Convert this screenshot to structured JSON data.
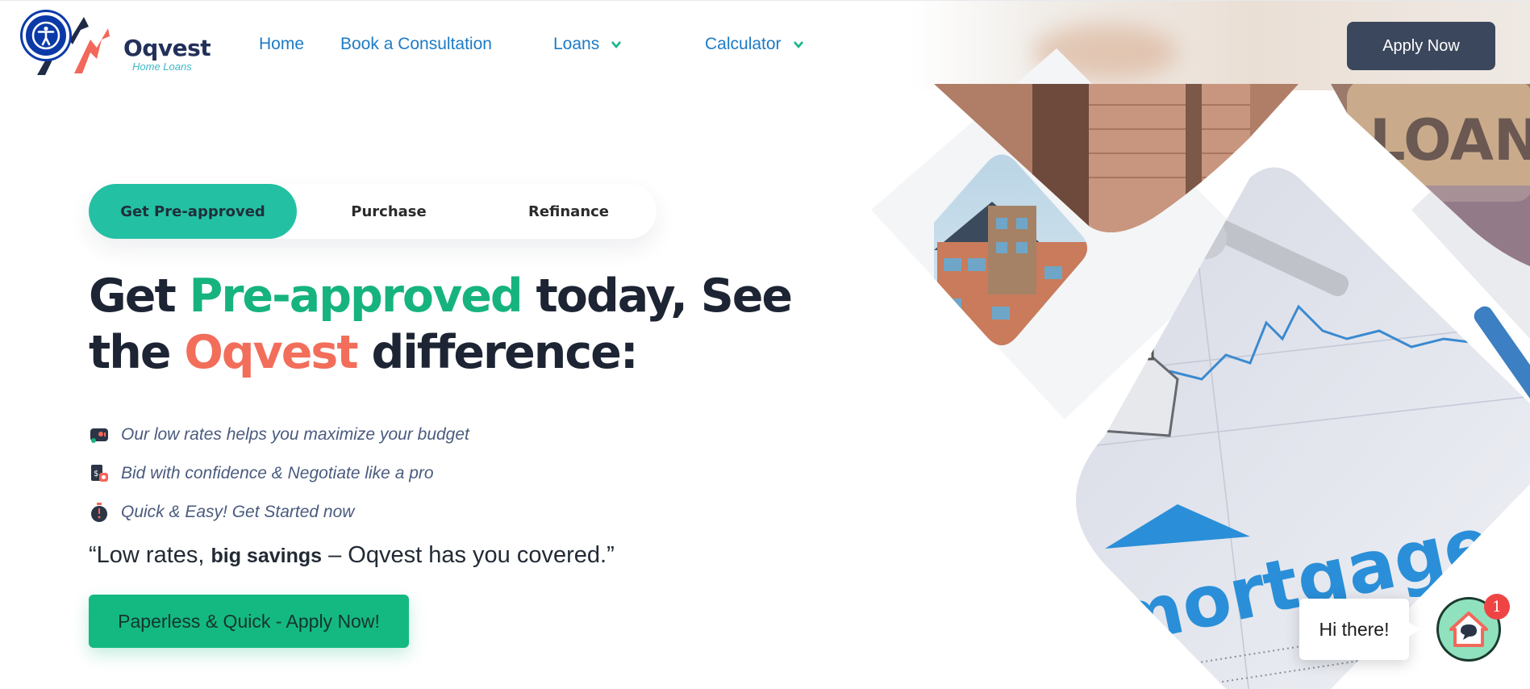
{
  "header": {
    "logo": {
      "name": "Oqvest",
      "tagline": "Home Loans"
    },
    "nav": [
      {
        "label": "Home"
      },
      {
        "label": "Book a Consultation"
      },
      {
        "label": "Loans",
        "has_dropdown": true
      },
      {
        "label": "Calculator",
        "has_dropdown": true
      }
    ],
    "apply_button": "Apply Now"
  },
  "hero": {
    "tabs": [
      {
        "label": "Get Pre-approved",
        "active": true
      },
      {
        "label": "Purchase",
        "active": false
      },
      {
        "label": "Refinance",
        "active": false
      }
    ],
    "headline": {
      "part1": "Get ",
      "highlight1": "Pre-approved",
      "part2": " today, See",
      "part3": "the ",
      "highlight2": "Oqvest",
      "part4": " difference:"
    },
    "features": [
      {
        "icon": "rates-card-icon",
        "text": "Our low rates helps you maximize your budget"
      },
      {
        "icon": "bid-document-icon",
        "text": "Bid with confidence & Negotiate like a pro"
      },
      {
        "icon": "stopwatch-icon",
        "text": "Quick & Easy! Get Started now"
      }
    ],
    "quote": {
      "before": "“Low rates, ",
      "bold": "big savings",
      "after": " – Oqvest has you covered.”"
    },
    "cta_button": "Paperless & Quick - Apply Now!",
    "images": {
      "loan_sack_text": "LOAN",
      "mortgage_text": "mortgage"
    }
  },
  "chat": {
    "greeting": "Hi there!",
    "badge_count": "1"
  },
  "colors": {
    "accent_green": "#16b37e",
    "accent_orange": "#f26e5a",
    "tab_active": "#24c0a3",
    "nav_blue": "#1d7bc6",
    "apply_button_bg": "#3b475c"
  }
}
